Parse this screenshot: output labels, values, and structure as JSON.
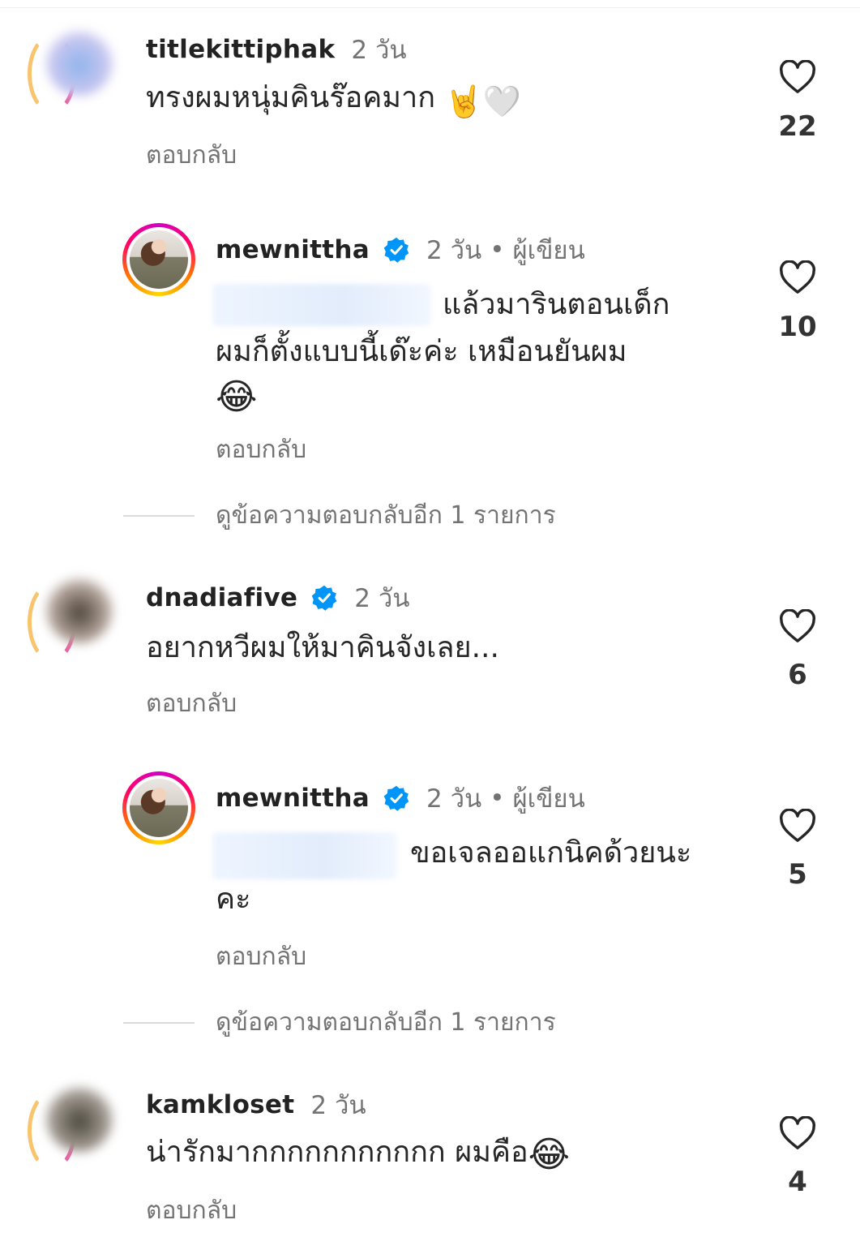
{
  "comments": [
    {
      "username": "titlekittiphak",
      "time": "2 วัน",
      "text": "ทรงผมหนุ่มคินร๊อคมาก",
      "emoji": "🤘🤍",
      "reply_label": "ตอบกลับ",
      "likes": "22"
    },
    {
      "username": "mewnittha",
      "time": "2 วัน",
      "author_badge": "ผู้เขียน",
      "text_line1": "แล้วมารินตอนเด็ก",
      "text_line2": "ผมก็ตั้งแบบนี้เด๊ะค่ะ เหมือนยันผม",
      "emoji": "😂",
      "reply_label": "ตอบกลับ",
      "likes": "10"
    },
    {
      "username": "dnadiafive",
      "time": "2 วัน",
      "text": "อยากหวีผมให้มาคินจังเลย...",
      "reply_label": "ตอบกลับ",
      "likes": "6"
    },
    {
      "username": "mewnittha",
      "time": "2 วัน",
      "author_badge": "ผู้เขียน",
      "text_line1": "ขอเจลออแกนิคด้วยนะ",
      "text_line2": "คะ",
      "reply_label": "ตอบกลับ",
      "likes": "5"
    },
    {
      "username": "kamkloset",
      "time": "2 วัน",
      "text": "น่ารักมากกกกกกกกกกก ผมคือ",
      "emoji": "😂",
      "reply_label": "ตอบกลับ",
      "likes": "4"
    }
  ],
  "view_more_replies": "ดูข้อความตอบกลับอีก 1 รายการ",
  "colors": {
    "verified": "#0095f6",
    "secondary_text": "#737373",
    "primary_text": "#262626"
  },
  "icons": {
    "like": "heart-outline-icon",
    "verified": "verified-badge-icon"
  }
}
